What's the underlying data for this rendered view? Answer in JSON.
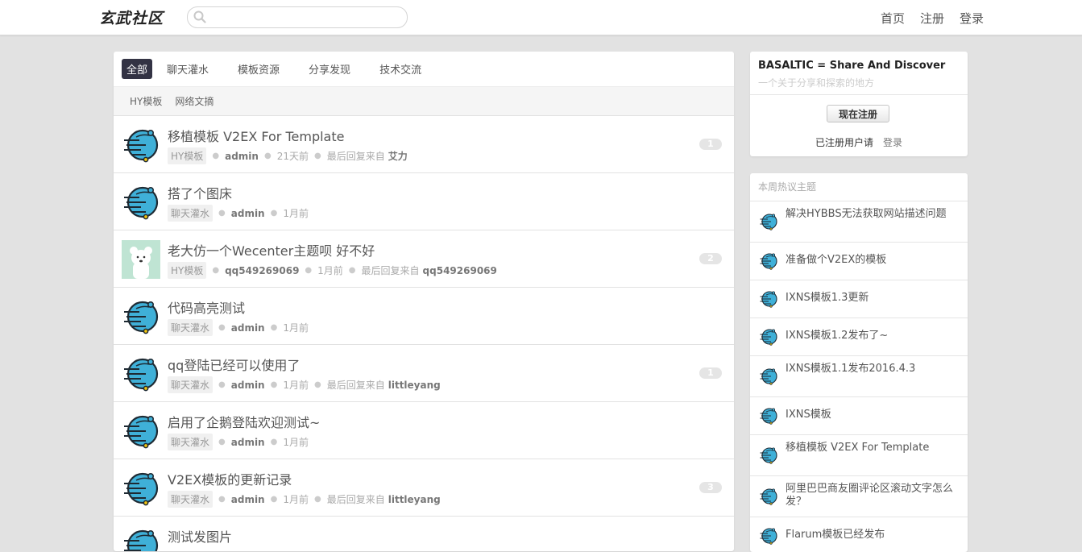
{
  "header": {
    "logo_text": "玄武社区",
    "search": {
      "value": "",
      "placeholder": ""
    },
    "nav": [
      "首页",
      "注册",
      "登录"
    ]
  },
  "tabs": [
    "全部",
    "聊天灌水",
    "模板资源",
    "分享发现",
    "技术交流"
  ],
  "active_tab": "全部",
  "subtabs": [
    "HY模板",
    "网络文摘"
  ],
  "topics": [
    {
      "title": "移植模板 V2EX For Template",
      "node": "HY模板",
      "author": "admin",
      "time": "21天前",
      "reply_label": "最后回复来自",
      "last_reply": "艾力",
      "count": "1",
      "avatar": "planet-icon"
    },
    {
      "title": "搭了个图床",
      "node": "聊天灌水",
      "author": "admin",
      "time": "1月前",
      "reply_label": "",
      "last_reply": "",
      "count": "",
      "avatar": "planet-icon"
    },
    {
      "title": "老大仿一个Wecenter主题呗 好不好",
      "node": "HY模板",
      "author": "qq549269069",
      "time": "1月前",
      "reply_label": "最后回复来自",
      "last_reply": "qq549269069",
      "count": "2",
      "avatar": "bear-avatar"
    },
    {
      "title": "代码高亮测试",
      "node": "聊天灌水",
      "author": "admin",
      "time": "1月前",
      "reply_label": "",
      "last_reply": "",
      "count": "",
      "avatar": "planet-icon"
    },
    {
      "title": "qq登陆已经可以使用了",
      "node": "聊天灌水",
      "author": "admin",
      "time": "1月前",
      "reply_label": "最后回复来自",
      "last_reply": "littleyang",
      "count": "1",
      "avatar": "planet-icon"
    },
    {
      "title": "启用了企鹅登陆欢迎测试~",
      "node": "聊天灌水",
      "author": "admin",
      "time": "1月前",
      "reply_label": "",
      "last_reply": "",
      "count": "",
      "avatar": "planet-icon"
    },
    {
      "title": "V2EX模板的更新记录",
      "node": "聊天灌水",
      "author": "admin",
      "time": "1月前",
      "reply_label": "最后回复来自",
      "last_reply": "littleyang",
      "count": "3",
      "avatar": "planet-icon"
    },
    {
      "title": "测试发图片",
      "node": "",
      "author": "",
      "time": "",
      "reply_label": "",
      "last_reply": "",
      "count": "",
      "avatar": "planet-icon"
    }
  ],
  "sidebar": {
    "site_title": "BASALTIC = Share And Discover",
    "site_subtitle": "一个关于分享和探索的地方",
    "register_button": "现在注册",
    "already_text": "已注册用户请",
    "login_link": "登录",
    "hot_title": "本周热议主题",
    "hot_topics": [
      "解决HYBBS无法获取网站描述问题",
      "准备做个V2EX的模板",
      "IXNS模板1.3更新",
      "IXNS模板1.2发布了~",
      "IXNS模板1.1发布2016.4.3",
      "IXNS模板",
      "移植模板 V2EX For Template",
      "阿里巴巴商友圈评论区滚动文字怎么发？",
      "Flarum模板已经发布"
    ]
  },
  "colors": {
    "accent_tab": "#333344",
    "planet": "#3fb0d8",
    "background": "#e2e2e2"
  }
}
